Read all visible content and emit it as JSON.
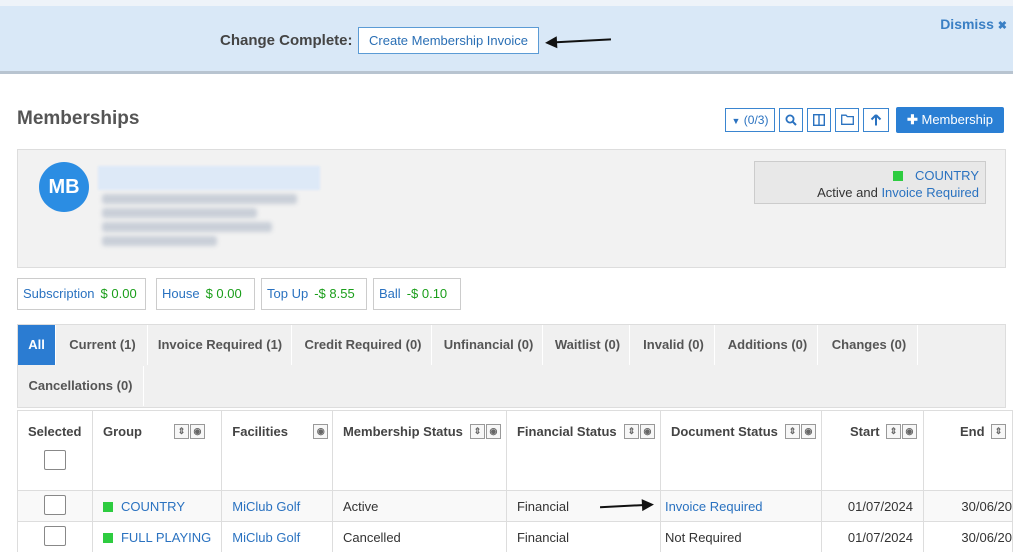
{
  "banner": {
    "label": "Change Complete:",
    "action_label": "Create Membership Invoice",
    "dismiss_label": "Dismiss",
    "dismiss_glyph": "✖"
  },
  "header": {
    "title": "Memberships",
    "toolbar": {
      "filter_label": "(0/3)",
      "add_label": "Membership",
      "icons": [
        "filter-dropdown-icon",
        "search-icon",
        "columns-icon",
        "folder-icon",
        "upload-arrow-icon"
      ]
    }
  },
  "member": {
    "initials": "MB",
    "status_group": "COUNTRY",
    "status_prefix": "Active and ",
    "status_link": "Invoice Required",
    "status_color": "#2ecc40"
  },
  "totals": [
    {
      "label": "Subscription",
      "value": "$ 0.00"
    },
    {
      "label": "House",
      "value": "$ 0.00"
    },
    {
      "label": "Top Up",
      "value": "-$ 8.55"
    },
    {
      "label": "Ball",
      "value": "-$ 0.10"
    }
  ],
  "tabs": [
    "All",
    "Current (1)",
    "Invoice Required (1)",
    "Credit Required (0)",
    "Unfinancial (0)",
    "Waitlist (0)",
    "Invalid (0)",
    "Additions (0)",
    "Changes (0)",
    "Cancellations (0)"
  ],
  "table": {
    "columns": [
      "Selected",
      "Group",
      "Facilities",
      "Membership Status",
      "Financial Status",
      "Document Status",
      "Start",
      "End"
    ],
    "rows": [
      {
        "group": "COUNTRY",
        "facilities": "MiClub Golf",
        "membership_status": "Active",
        "financial_status": "Financial",
        "document_status": "Invoice Required",
        "start": "01/07/2024",
        "end": "30/06/20"
      },
      {
        "group": "FULL PLAYING",
        "facilities": "MiClub Golf",
        "membership_status": "Cancelled",
        "financial_status": "Financial",
        "document_status": "Not Required",
        "start": "01/07/2024",
        "end": "30/06/20"
      }
    ]
  }
}
